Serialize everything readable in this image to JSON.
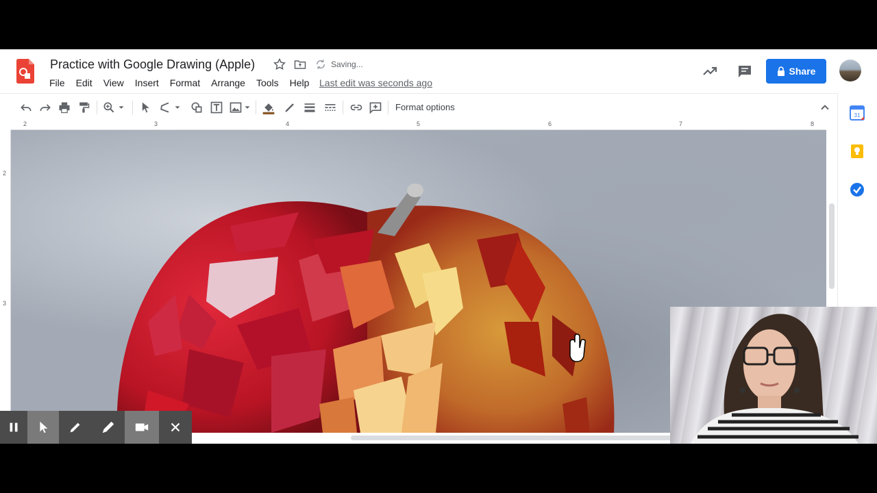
{
  "header": {
    "title": "Practice with Google Drawing (Apple)",
    "saving_status": "Saving...",
    "last_edit": "Last edit was seconds ago",
    "share_label": "Share"
  },
  "menu": [
    "File",
    "Edit",
    "View",
    "Insert",
    "Format",
    "Arrange",
    "Tools",
    "Help"
  ],
  "toolbar": {
    "format_options": "Format options",
    "icons": [
      "undo-icon",
      "redo-icon",
      "print-icon",
      "paint-format-icon",
      "zoom-icon",
      "select-icon",
      "line-icon",
      "shape-icon",
      "text-box-icon",
      "image-icon",
      "fill-color-icon",
      "border-color-icon",
      "border-weight-icon",
      "border-dash-icon",
      "link-icon",
      "add-comment-icon"
    ]
  },
  "ruler": {
    "horizontal": [
      "2",
      "3",
      "4",
      "5",
      "6",
      "7",
      "8"
    ],
    "vertical": [
      "2",
      "3"
    ]
  },
  "side_panel": [
    "calendar-icon",
    "keep-icon",
    "tasks-icon"
  ],
  "calendar_day": "31",
  "recording_controls": [
    "pause-icon",
    "pointer-icon",
    "pen-icon",
    "highlighter-icon",
    "camera-icon",
    "close-icon"
  ],
  "colors": {
    "share_blue": "#1a73e8",
    "logo_red": "#ea4335",
    "recording_bar": "#4b4b4b"
  }
}
